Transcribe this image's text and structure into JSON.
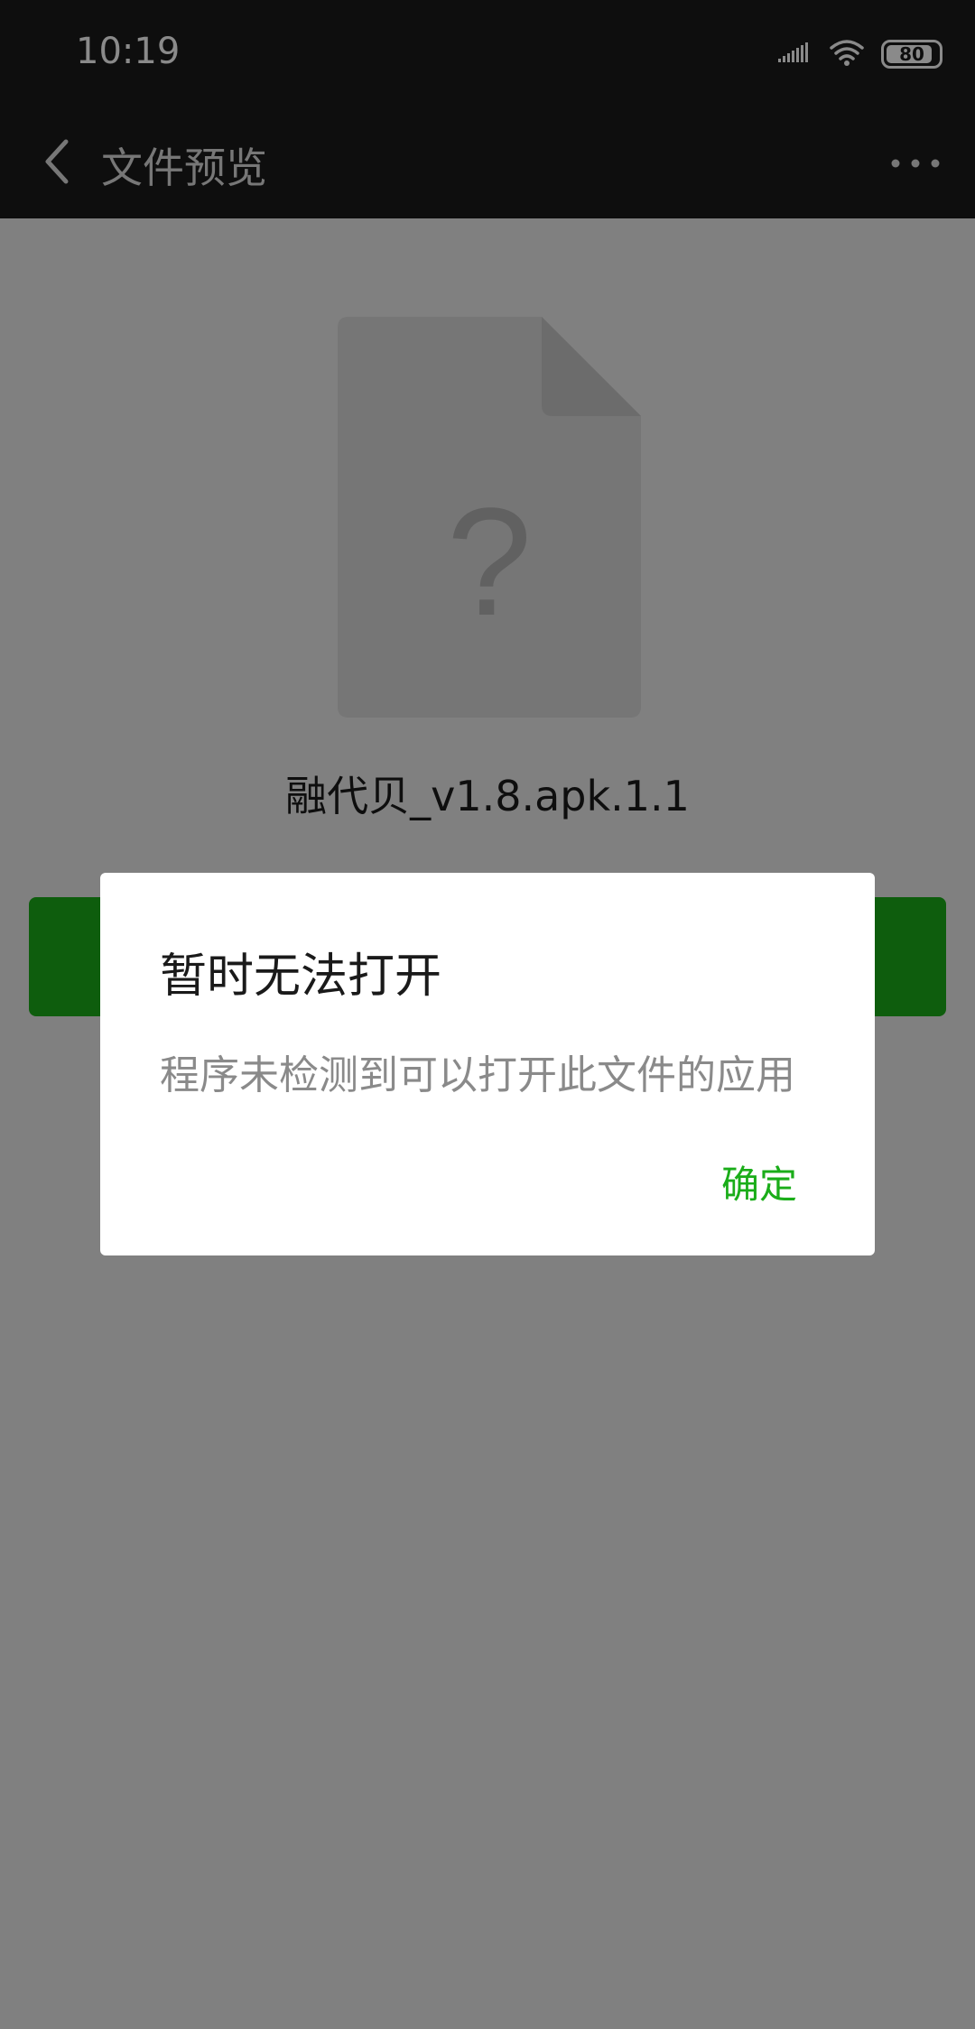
{
  "status_bar": {
    "time": "10:19",
    "battery_level": "80",
    "icons": [
      "signal-icon",
      "wifi-icon",
      "battery-icon"
    ]
  },
  "nav": {
    "title": "文件预览",
    "back_icon": "chevron-left-icon",
    "more_icon": "more-dots-icon"
  },
  "content": {
    "file_name": "融代贝_v1.8.apk.1.1",
    "file_icon": "unknown-file-icon",
    "file_icon_glyph": "?"
  },
  "dialog": {
    "title": "暂时无法打开",
    "message": "程序未检测到可以打开此文件的应用",
    "confirm_label": "确定"
  },
  "colors": {
    "accent": "#1aad19",
    "bar_background": "#1b1b1b",
    "page_background": "#ededed",
    "overlay": "rgba(0,0,0,0.46)"
  }
}
